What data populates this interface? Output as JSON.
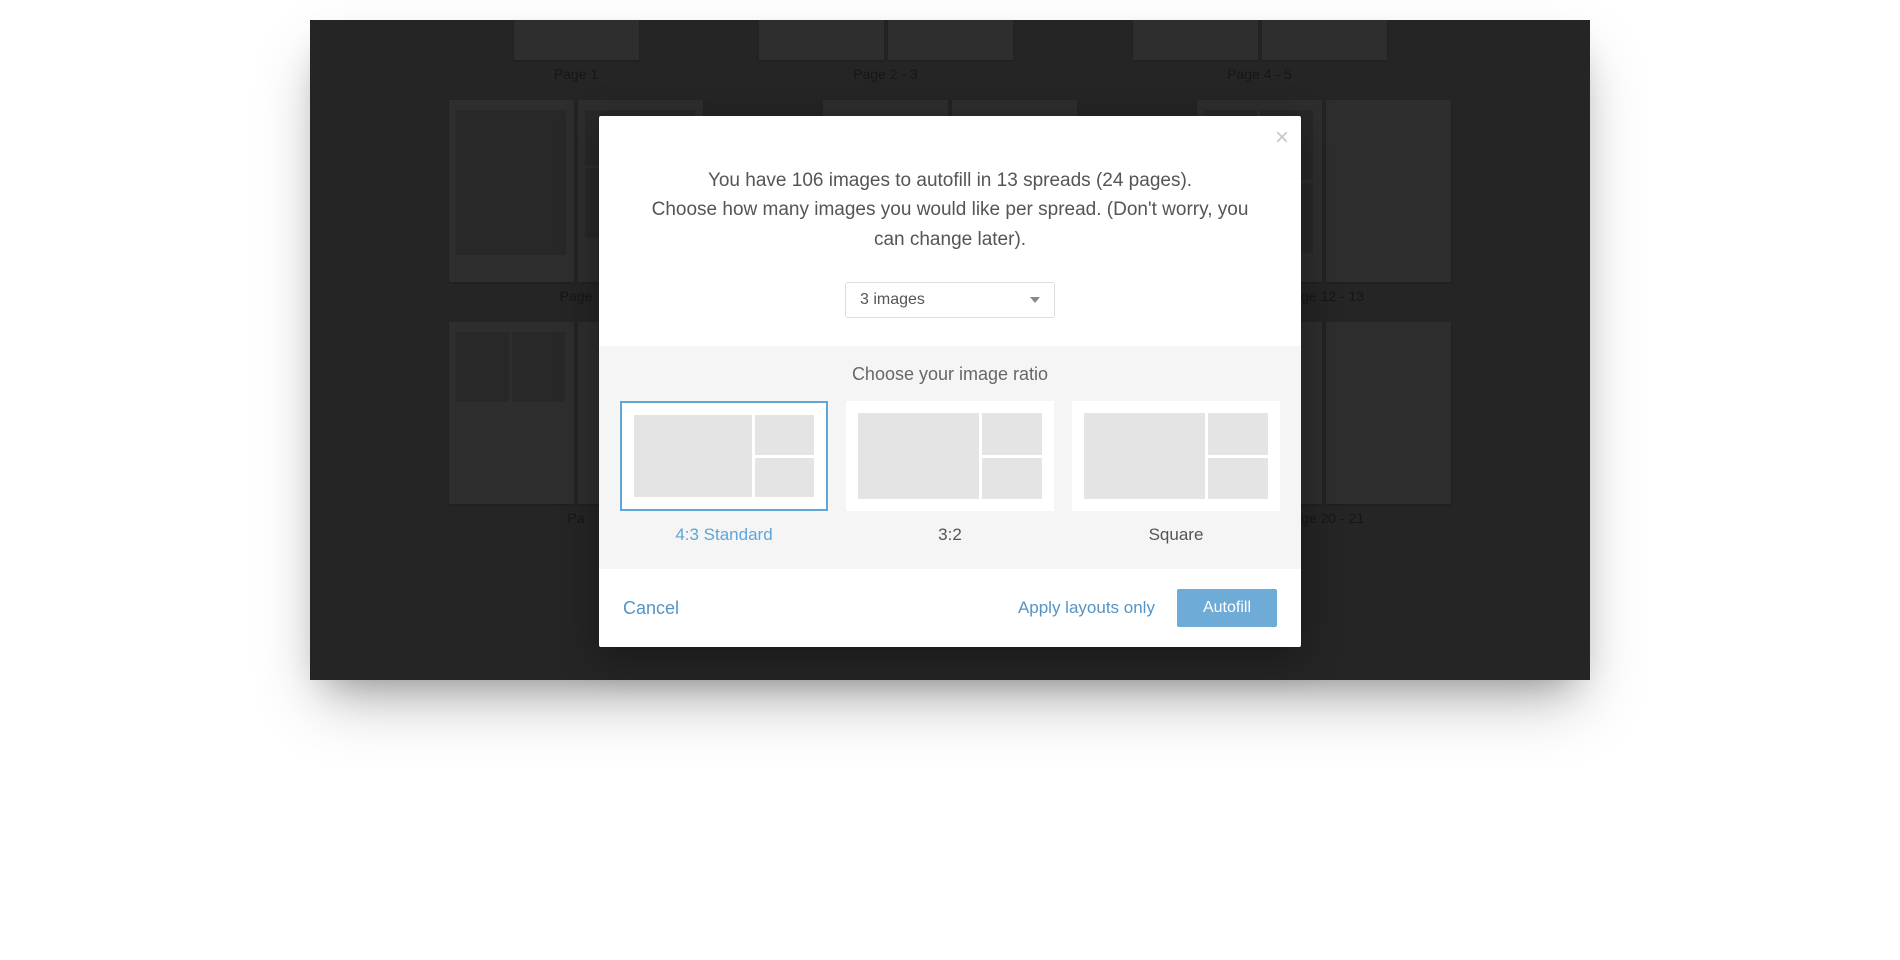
{
  "background": {
    "rows": [
      {
        "labels": [
          "Page 1",
          "Page 2 - 3",
          "Page 4 - 5"
        ]
      },
      {
        "labels": [
          "Page",
          "",
          "Page 12 - 13"
        ]
      },
      {
        "labels": [
          "Pa",
          "",
          "Page 20 - 21"
        ]
      }
    ]
  },
  "modal": {
    "close": "×",
    "line1": "You have 106 images to autofill in 13 spreads (24 pages).",
    "line2": "Choose how many images you would like per spread. (Don't worry, you can change later).",
    "dropdown": {
      "selected": "3 images"
    },
    "ratio": {
      "title": "Choose your image ratio",
      "options": [
        {
          "label": "4:3 Standard",
          "selected": true
        },
        {
          "label": "3:2",
          "selected": false
        },
        {
          "label": "Square",
          "selected": false
        }
      ]
    },
    "footer": {
      "cancel": "Cancel",
      "apply_only": "Apply layouts only",
      "autofill": "Autofill"
    }
  }
}
